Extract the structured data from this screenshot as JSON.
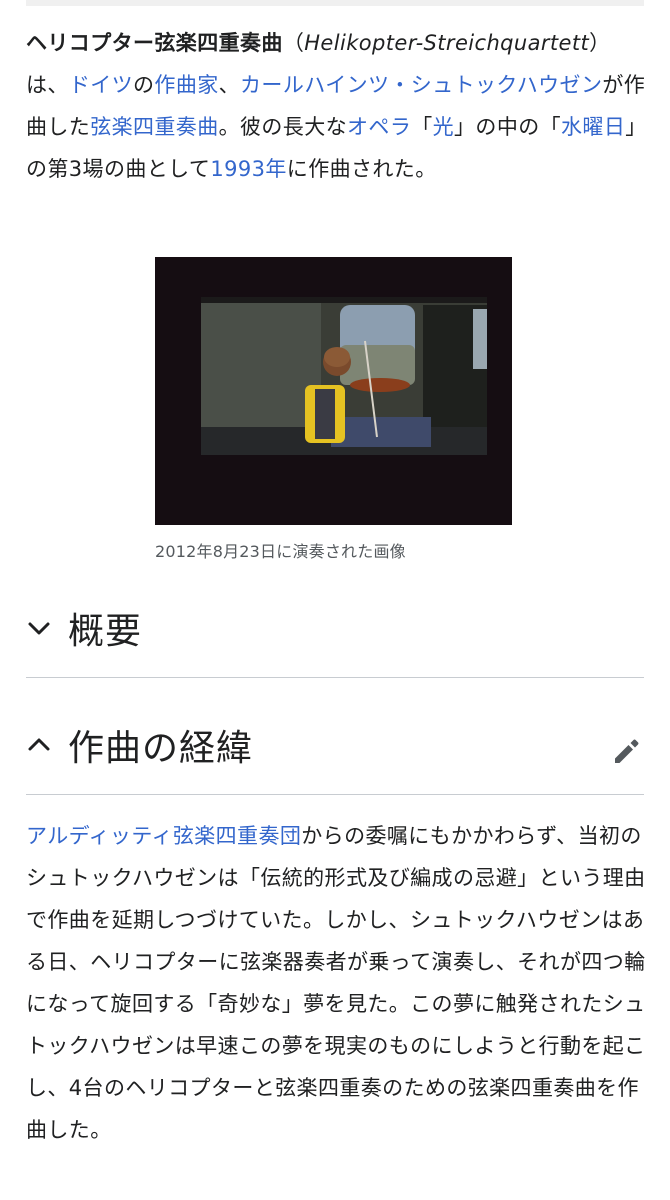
{
  "lead": {
    "title_bold": "ヘリコプター弦楽四重奏曲",
    "paren_open": "（",
    "title_italic": "Helikopter-Streichquartett",
    "paren_close": "）は、",
    "link_germany": "ドイツ",
    "t1": "の",
    "link_composer": "作曲家",
    "t2": "、",
    "link_stockhausen": "カールハインツ・シュトックハウゼン",
    "t3": "が作曲した",
    "link_quartet": "弦楽四重奏曲",
    "t4": "。彼の長大な",
    "link_opera": "オペラ",
    "t5": "「",
    "link_licht": "光",
    "t6": "」の中の「",
    "link_wednesday": "水曜日",
    "t7": "」の第3場の曲として",
    "link_year": "1993年",
    "t8": "に作曲された。"
  },
  "figure": {
    "caption": "2012年8月23日に演奏された画像"
  },
  "sections": {
    "overview": {
      "title": "概要",
      "state": "collapsed",
      "icon": "chevron-down-icon"
    },
    "history": {
      "title": "作曲の経緯",
      "state": "expanded",
      "icon": "chevron-up-icon",
      "edit_icon": "pencil-icon"
    }
  },
  "history_body": {
    "link_arditti": "アルディッティ弦楽四重奏団",
    "text": "からの委嘱にもかかわらず、当初のシュトックハウゼンは「伝統的形式及び編成の忌避」という理由で作曲を延期しつづけていた。しかし、シュトックハウゼンはある日、ヘリコプターに弦楽器奏者が乗って演奏し、それが四つ輪になって旋回する「奇妙な」夢を見た。この夢に触発されたシュトックハウゼンは早速この夢を現実のものにしようと行動を起こし、4台のヘリコプターと弦楽四重奏のための弦楽四重奏曲を作曲した。"
  },
  "colors": {
    "link": "#3366cc",
    "text": "#202122",
    "caption": "#54595d",
    "rule": "#c8ccd1"
  }
}
